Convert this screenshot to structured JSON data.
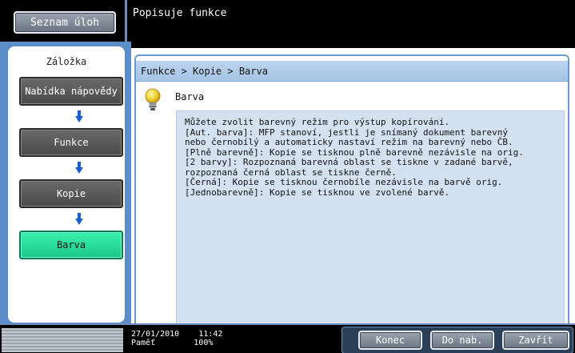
{
  "top": {
    "task_list_label": "Seznam úloh",
    "title": "Popisuje funkce"
  },
  "sidebar": {
    "tab_label": "Záložka",
    "items": [
      {
        "label": "Nabídka nápovědy"
      },
      {
        "label": "Funkce"
      },
      {
        "label": "Kopie"
      },
      {
        "label": "Barva"
      }
    ]
  },
  "main": {
    "breadcrumb": "Funkce > Kopie > Barva",
    "heading": "Barva",
    "description": "Můžete zvolit barevný režim pro výstup kopírování.\n[Aut. barva]: MFP stanoví, jestli je snímaný dokument barevný\nnebo černobílý a automaticky nastaví režim na barevný nebo ČB.\n[Plně barevně]: Kopie se tisknou plně barevně nezávisle na orig.\n[2 barvy]: Rozpoznaná barevná oblast se tiskne v zadané barvě,\nrozpoznaná černá oblast se tiskne černě.\n[Černá]: Kopie se tisknou černobíle nezávisle na barvě orig.\n[Jednobarevně]: Kopie se tisknou ve zvolené barvě."
  },
  "status": {
    "date": "27/01/2010",
    "time": "11:42",
    "memory_label": "Paměť",
    "memory_value": "100%",
    "buttons": {
      "end": "Konec",
      "back": "Do nab.",
      "close": "Zavřít"
    }
  },
  "colors": {
    "accent_blue": "#5b8ec8",
    "active_green": "#18c88a"
  }
}
